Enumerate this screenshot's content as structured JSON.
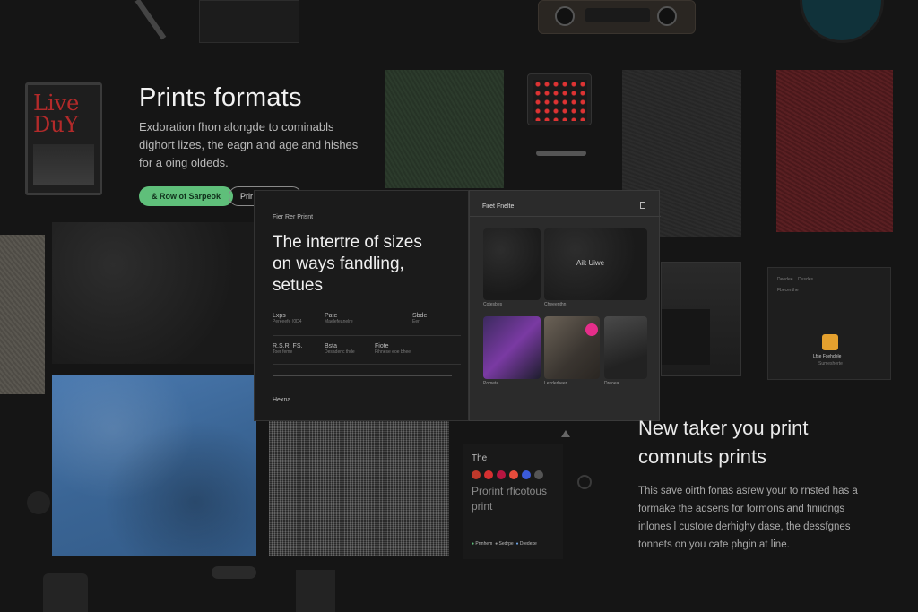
{
  "hero": {
    "title": "Prints formats",
    "desc_line1": "Exdoration fhon alongde to cominabls",
    "desc_line2": "dighort lizes, the eagn and age and hishes",
    "desc_line3": "for a oing oldeds.",
    "primary_button": "& Row of Sarpeok",
    "secondary_button": "Prir"
  },
  "book": {
    "title_line1": "Live",
    "title_line2": "DuY"
  },
  "panel": {
    "eyebrow": "Fier Rer Prisnt",
    "title_line1": "The intertre of sizes",
    "title_line2": "on ways fandling,",
    "title_line3": "setues",
    "specs": [
      {
        "label": "Lxps",
        "sub": "Pereeefe (0D4"
      },
      {
        "label": "Pate",
        "sub": "Maelefeanelre"
      },
      {
        "label": "Sbde",
        "sub": "Eer"
      },
      {
        "label": "R.S.R. FS.",
        "sub": "Toer feme"
      },
      {
        "label": "Bsta",
        "sub": "Desadenc thde"
      },
      {
        "label": "Fiote",
        "sub": "Fihnese eoe bhee"
      }
    ],
    "footer": "Hexna",
    "right_title": "Firet Fnelte",
    "thumb_main_label": "Aik Uiwe",
    "captions": [
      "Cotesbes",
      "Cheeenthn",
      "Pomete",
      "Lexderbeer",
      "Dreoea"
    ]
  },
  "palette_card": {
    "title": "The",
    "subtitle_line1": "Prorint rficotous",
    "subtitle_line2": "print",
    "swatch_colors": [
      "#c0392b",
      "#d63031",
      "#b71540",
      "#e74c3c",
      "#3b5bdb",
      "#555555"
    ],
    "items": [
      "Prmhem",
      "Sedrpe",
      "Dredexe"
    ]
  },
  "side_card": {
    "line1": "Deedee    Dusdes",
    "line2": "Fbecenthe",
    "label1": "Lfse Fsehdele",
    "label2": "Sumesherte"
  },
  "bottom_right": {
    "title_line1": "New taker you print",
    "title_line2": "comnuts prints",
    "desc_line1": "This save oirth fonas asrew your to rnsted has a",
    "desc_line2": "formake the adsens for formons and finiidngs",
    "desc_line3": "inlones l custore derhighy dase, the dessfgnes",
    "desc_line4": "tonnets on you cate phgin at line."
  },
  "colors": {
    "accent_green": "#5fbf7a",
    "badge_orange": "#e4a02e"
  },
  "icons": [
    "bookmark-icon",
    "check-icon",
    "circle-icon",
    "triangle-icon"
  ]
}
